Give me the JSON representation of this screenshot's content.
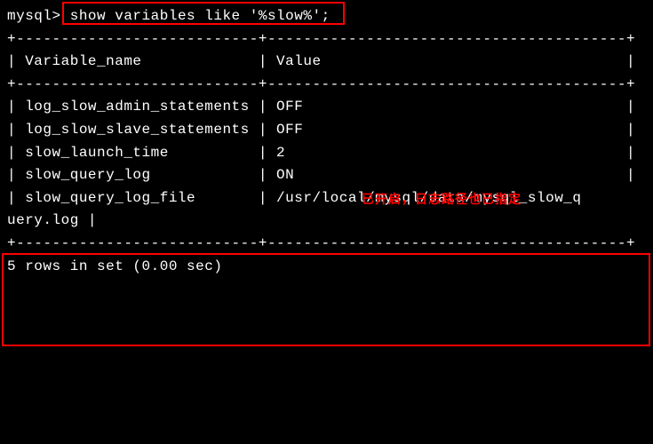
{
  "terminal": {
    "prompt": "mysql> ",
    "command": "show variables like '%slow%';",
    "divider1": "+---------------------------+----------------------------------------+",
    "header": "| Variable_name             | Value                                  |",
    "divider2": "+---------------------------+----------------------------------------+",
    "row1": "| log_slow_admin_statements | OFF                                    |",
    "row2": "| log_slow_slave_statements | OFF                                    |",
    "row3": "| slow_launch_time          | 2                                      |",
    "row4": "| slow_query_log            | ON                                     |",
    "row5a": "| slow_query_log_file       | /usr/local/mysql/data/mysql_slow_q",
    "row5b": "uery.log |",
    "divider3": "+---------------------------+----------------------------------------+",
    "footer": "5 rows in set (0.00 sec)"
  },
  "annotation": "已开启，日志路径也已指定",
  "chart_data": {
    "type": "table",
    "title": "MySQL SHOW VARIABLES LIKE '%slow%'",
    "columns": [
      "Variable_name",
      "Value"
    ],
    "rows": [
      {
        "Variable_name": "log_slow_admin_statements",
        "Value": "OFF"
      },
      {
        "Variable_name": "log_slow_slave_statements",
        "Value": "OFF"
      },
      {
        "Variable_name": "slow_launch_time",
        "Value": "2"
      },
      {
        "Variable_name": "slow_query_log",
        "Value": "ON"
      },
      {
        "Variable_name": "slow_query_log_file",
        "Value": "/usr/local/mysql/data/mysql_slow_query.log"
      }
    ],
    "row_count": 5,
    "time_sec": 0.0
  }
}
